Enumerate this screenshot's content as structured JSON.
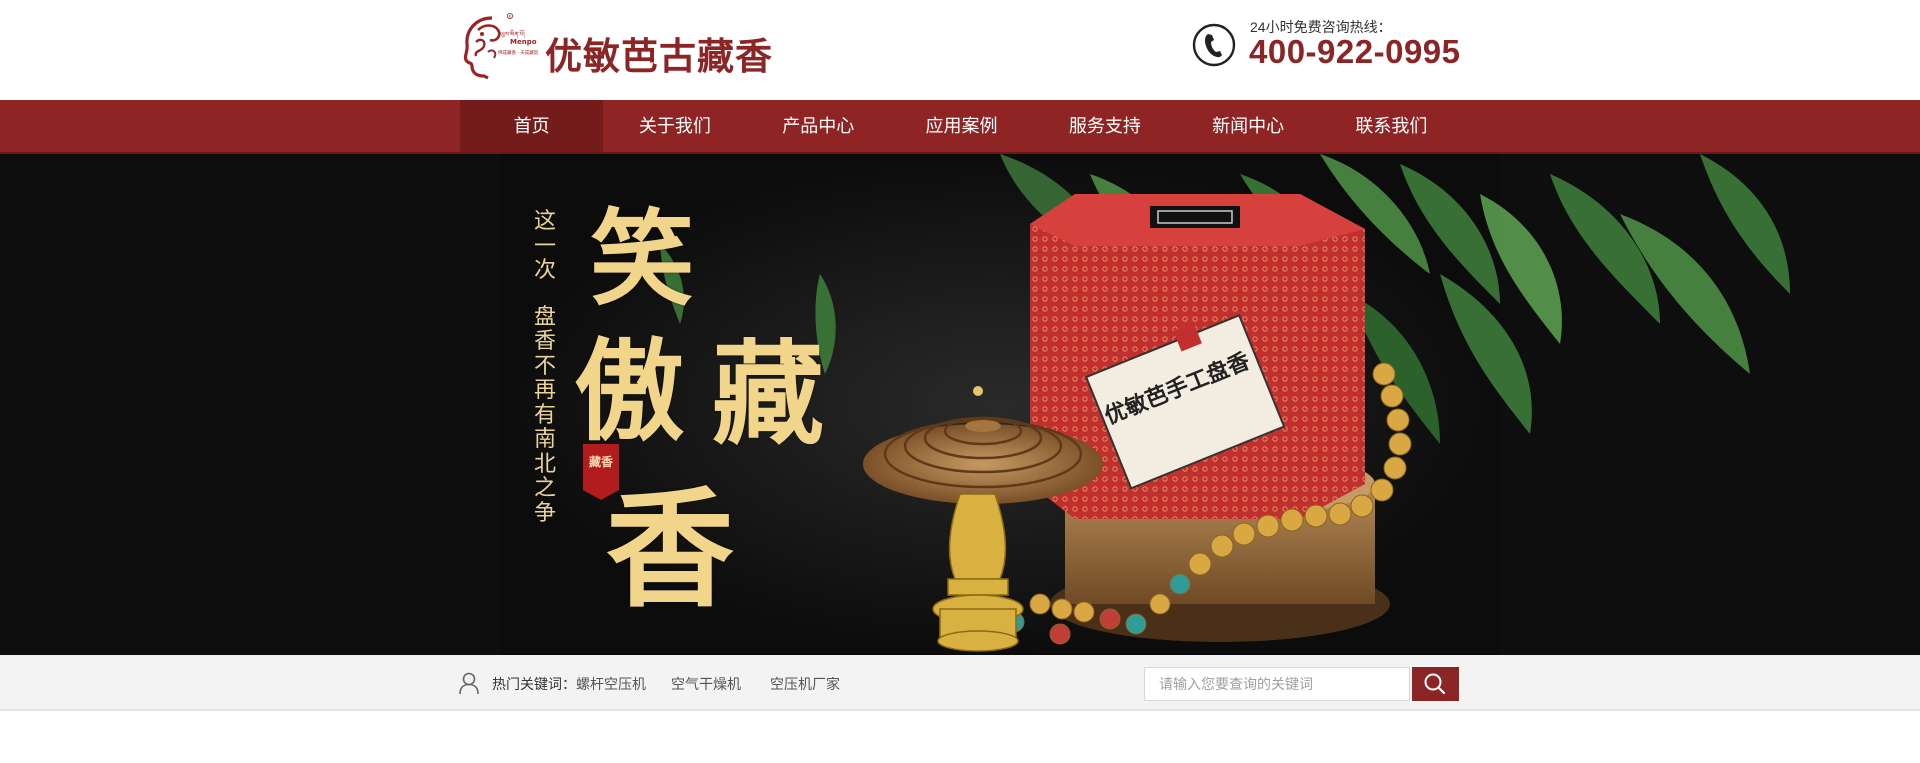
{
  "header": {
    "brand_name": "优敏芭古藏香",
    "logo_text": "Menpo",
    "hotline_label": "24小时免费咨询热线：",
    "hotline_number": "400-922-0995"
  },
  "nav": {
    "items": [
      {
        "label": "首页",
        "active": true
      },
      {
        "label": "关于我们"
      },
      {
        "label": "产品中心"
      },
      {
        "label": "应用案例"
      },
      {
        "label": "服务支持"
      },
      {
        "label": "新闻中心"
      },
      {
        "label": "联系我们"
      }
    ]
  },
  "banner": {
    "vertical_line1": "这一次",
    "vertical_line2": "盘香不再有南北之争",
    "calligraphy": [
      "笑",
      "傲",
      "藏",
      "香"
    ],
    "seal_text": "藏香",
    "box_label": "优敏芭手工盘香"
  },
  "search": {
    "hot_label": "热门关键词：",
    "keywords": [
      "螺杆空压机",
      "空气干燥机",
      "空压机厂家"
    ],
    "placeholder": "请输入您要查询的关键词"
  },
  "colors": {
    "brand": "#8b2526",
    "nav_bg": "#8e2524",
    "nav_active": "#741b1b",
    "gold": "#f1d58b"
  }
}
